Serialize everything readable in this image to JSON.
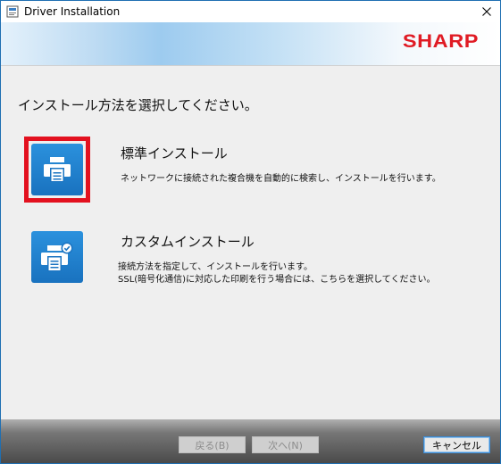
{
  "window": {
    "title": "Driver Installation",
    "brand_logo": "SHARP",
    "brand_color": "#e01b24",
    "accent_color": "#1f7fd0"
  },
  "main": {
    "heading": "インストール方法を選択してください。",
    "options": [
      {
        "title": "標準インストール",
        "description": [
          "ネットワークに接続された複合機を自動的に検索し、インストールを行います。"
        ],
        "icon": "printer-icon",
        "selected": true
      },
      {
        "title": "カスタムインストール",
        "description": [
          "接続方法を指定して、インストールを行います。",
          "SSL(暗号化通信)に対応した印刷を行う場合には、こちらを選択してください。"
        ],
        "icon": "printer-check-icon",
        "selected": false
      }
    ]
  },
  "footer": {
    "back_label": "戻る(B)",
    "next_label": "次へ(N)",
    "cancel_label": "キャンセル"
  }
}
